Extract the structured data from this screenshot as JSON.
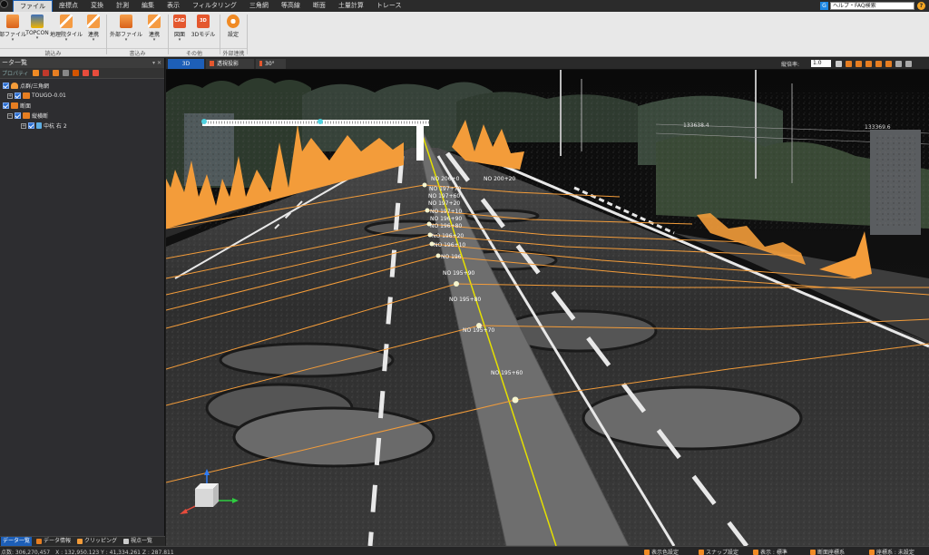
{
  "menubar": {
    "items": [
      "ファイル",
      "座標点",
      "変換",
      "計測",
      "編集",
      "表示",
      "フィルタリング",
      "三角網",
      "等高線",
      "断面",
      "土量計算",
      "トレース"
    ],
    "active_index": 0,
    "help_search": "ヘルプ・FAQ検索"
  },
  "ribbon": {
    "buttons": [
      {
        "label": "部ファイル",
        "icon": "import-file-icon"
      },
      {
        "label": "TOPCON",
        "icon": "topcon-icon"
      },
      {
        "label": "地理院タイル",
        "icon": "gsi-tile-icon"
      },
      {
        "label": "連携",
        "icon": "link-icon"
      },
      {
        "label": "外部ファイル",
        "icon": "export-file-icon"
      },
      {
        "label": "連携",
        "icon": "link-icon"
      },
      {
        "label": "図面",
        "icon": "cad-icon"
      },
      {
        "label": "3Dモデル",
        "icon": "3d-model-icon"
      },
      {
        "label": "設定",
        "icon": "gear-icon"
      }
    ],
    "groups": [
      "読込み",
      "書込み",
      "その他",
      "外部連携"
    ],
    "cad_text": "CAD",
    "threed_text": "3D"
  },
  "leftpanel": {
    "title": "ータ一覧",
    "title_ctrls": "▾ ✕",
    "toolbar_label": "プロパティ",
    "tree": [
      {
        "label": "点群/三角網",
        "level": 0
      },
      {
        "label": "TOUGO-0.01",
        "level": 1
      },
      {
        "label": "断面",
        "level": 0
      },
      {
        "label": "縦横断",
        "level": 1
      },
      {
        "label": "中杭 右 2",
        "level": 2
      }
    ],
    "tabs": [
      "データ一覧",
      "データ情報",
      "クリッピング",
      "視点一覧"
    ],
    "active_tab": 0
  },
  "viewport": {
    "tabs": [
      "3D",
      "透視投影",
      "30°"
    ],
    "zoom_label": "縦倍率:",
    "zoom_value": "1.0",
    "stations": [
      "NO 206+0",
      "NO 200+20",
      "NO 197+70",
      "NO 197+60",
      "NO 197+20",
      "NO 197+10",
      "NO 196+90",
      "NO 196+80",
      "NO 196+20",
      "NO 196+10",
      "NO 196",
      "NO 195+90",
      "NO 195+80",
      "NO 195+70",
      "NO 195+60"
    ],
    "distance_labels": [
      "133638.4",
      "133369.6"
    ]
  },
  "statusbar": {
    "coords": "点数: 306,270,457　X : 132,950.123  Y : 41,334.261  Z : 287.811",
    "items": [
      "表示色設定",
      "スナップ設定",
      "表示 : 標準",
      "断面座標系",
      "座標系 : 未設定"
    ]
  },
  "colors": {
    "accent": "#1d5fb8",
    "profile_orange": "#f39c3a",
    "centerline": "#e5e000",
    "road": "#3a3a3a",
    "lane_marking": "#e8e8e8"
  }
}
